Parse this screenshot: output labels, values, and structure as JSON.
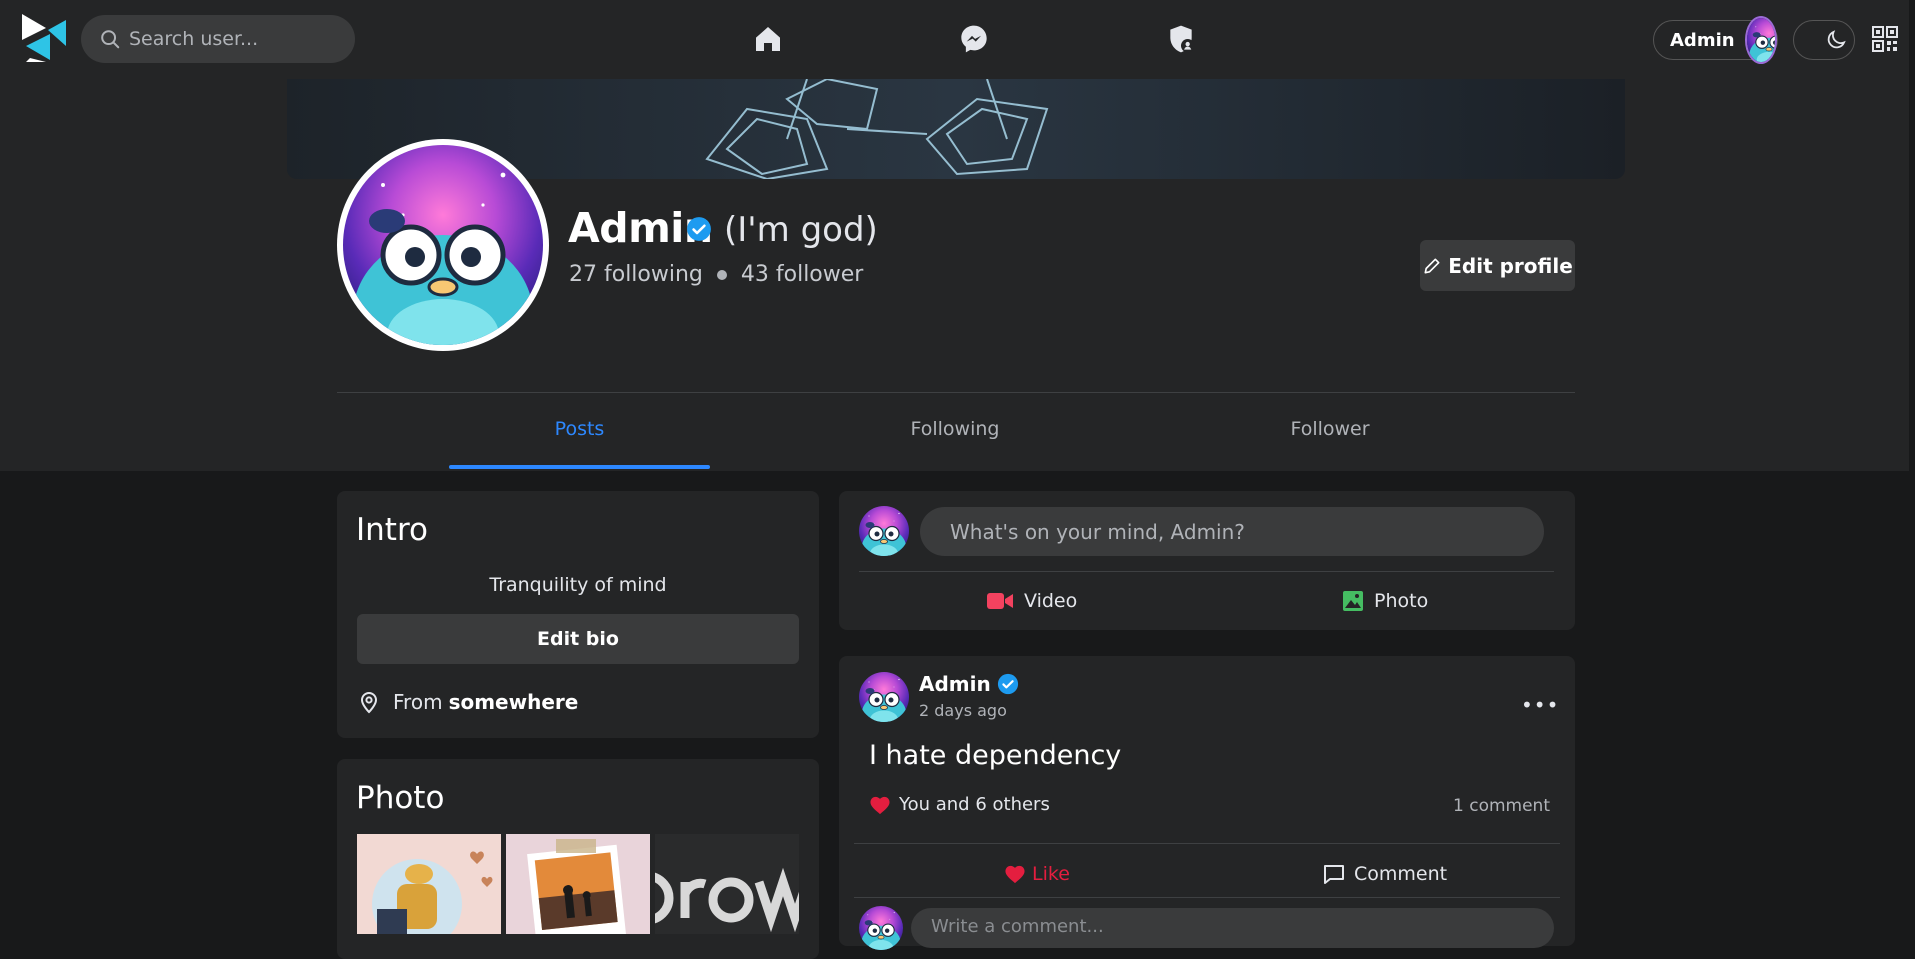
{
  "navbar": {
    "search_placeholder": "Search user...",
    "user_name": "Admin"
  },
  "profile": {
    "name": "Admin",
    "tagline": "(I'm god)",
    "following": "27 following",
    "followers": "43 follower",
    "edit_profile_label": "Edit profile"
  },
  "tabs": [
    {
      "label": "Posts",
      "active": true
    },
    {
      "label": "Following",
      "active": false
    },
    {
      "label": "Follower",
      "active": false
    }
  ],
  "intro": {
    "title": "Intro",
    "bio": "Tranquility of mind",
    "edit_bio_label": "Edit bio",
    "from_prefix": "From",
    "from_place": "somewhere"
  },
  "photos": {
    "title": "Photo"
  },
  "composer": {
    "placeholder": "What's on your mind, Admin?",
    "video_label": "Video",
    "photo_label": "Photo"
  },
  "post": {
    "author": "Admin",
    "time": "2 days ago",
    "more": "•••",
    "text": "I hate dependency",
    "likes_text": "You and 6 others",
    "comments_count": "1 comment",
    "like_label": "Like",
    "comment_label": "Comment",
    "comment_placeholder": "Write a comment..."
  },
  "colors": {
    "accent": "#2d88ff",
    "like_red": "#e41e3f",
    "video_red": "#f3425f",
    "photo_green": "#45bd62",
    "verified_blue": "#1d9bf0"
  }
}
